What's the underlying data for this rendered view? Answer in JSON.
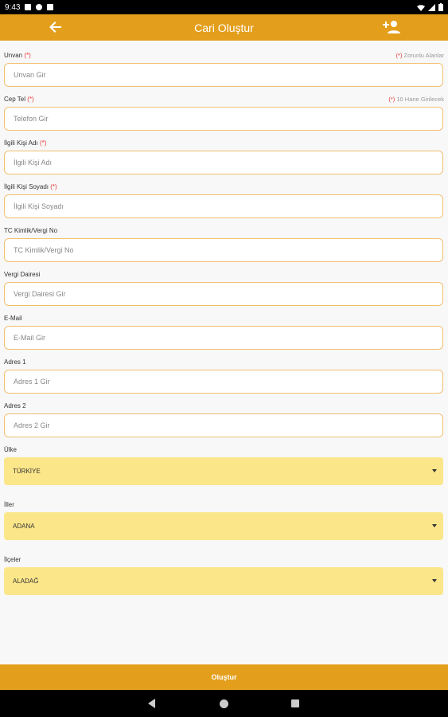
{
  "status_bar": {
    "time": "9:43"
  },
  "app_bar": {
    "title": "Cari Oluştur"
  },
  "required_mark": "(*)",
  "fields": [
    {
      "label": "Unvan",
      "required": true,
      "placeholder": "Unvan Gir",
      "note": "Zorunlu Alanlar"
    },
    {
      "label": "Cep Tel",
      "required": true,
      "placeholder": "Telefon Gir",
      "note": "10 Hane Girilecek"
    },
    {
      "label": "İlgili Kişi Adı",
      "required": true,
      "placeholder": "İlgili Kişi Adı",
      "note": ""
    },
    {
      "label": "İlgili Kişi Soyadı",
      "required": true,
      "placeholder": "İlgili Kişi Soyadı",
      "note": ""
    },
    {
      "label": "TC Kimlik/Vergi No",
      "required": false,
      "placeholder": "TC Kimlik/Vergi No",
      "note": ""
    },
    {
      "label": "Vergi Dairesi",
      "required": false,
      "placeholder": "Vergi Dairesi Gir",
      "note": ""
    },
    {
      "label": "E-Mail",
      "required": false,
      "placeholder": "E-Mail Gir",
      "note": ""
    },
    {
      "label": "Adres 1",
      "required": false,
      "placeholder": "Adres 1 Gir",
      "note": ""
    },
    {
      "label": "Adres 2",
      "required": false,
      "placeholder": "Adres 2 Gir",
      "note": ""
    }
  ],
  "selects": [
    {
      "label": "Ülke",
      "value": "TÜRKİYE"
    },
    {
      "label": "İller",
      "value": "ADANA"
    },
    {
      "label": "İlçeler",
      "value": "ALADAĞ"
    }
  ],
  "submit_label": "Oluştur",
  "colors": {
    "accent": "#e39f1c",
    "select_bg": "#fbe68a",
    "required": "#e53935",
    "input_border": "#f0c070"
  },
  "icons": {
    "back": "arrow-left-icon",
    "action": "add-person-icon"
  }
}
